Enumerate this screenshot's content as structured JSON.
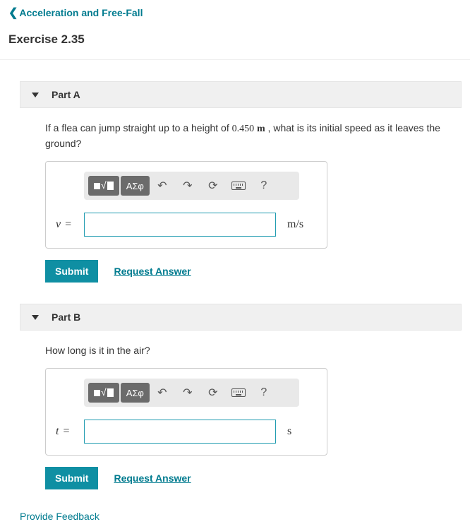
{
  "nav": {
    "back_label": "Acceleration and Free-Fall"
  },
  "page_title": "Exercise 2.35",
  "buttons": {
    "submit": "Submit",
    "request": "Request Answer"
  },
  "toolbar": {
    "greek": "ΑΣφ",
    "help": "?"
  },
  "parts": [
    {
      "title": "Part A",
      "question_pre": "If a flea can jump straight up to a height of ",
      "value": "0.450",
      "value_unit": "m",
      "question_post": " , what is its initial speed as it leaves the ground?",
      "var": "v",
      "unit": "m/s",
      "input": ""
    },
    {
      "title": "Part B",
      "question_pre": "How long is it in the air?",
      "value": "",
      "value_unit": "",
      "question_post": "",
      "var": "t",
      "unit": "s",
      "input": ""
    }
  ],
  "feedback": "Provide Feedback"
}
